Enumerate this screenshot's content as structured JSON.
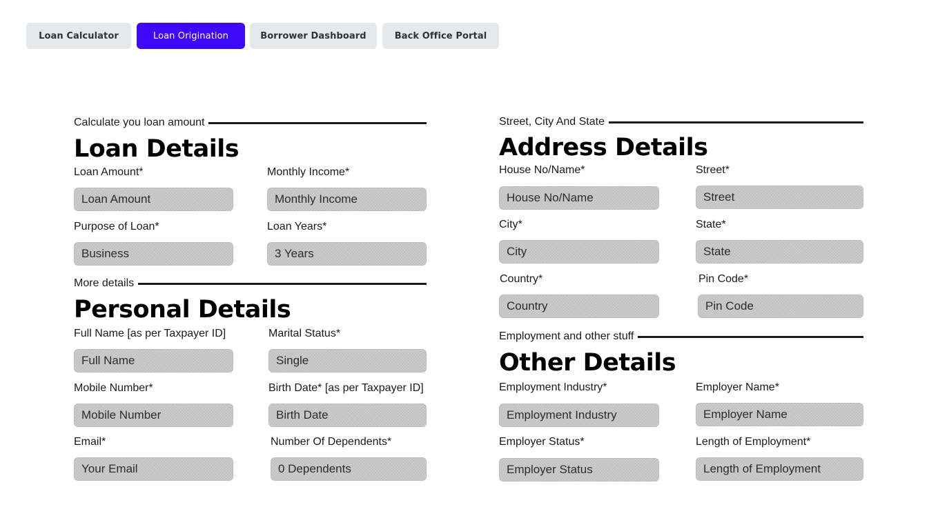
{
  "tabs": [
    {
      "label": "Loan Calculator",
      "active": false
    },
    {
      "label": "Loan Origination",
      "active": true
    },
    {
      "label": "Borrower Dashboard",
      "active": false
    },
    {
      "label": "Back Office Portal",
      "active": false
    }
  ],
  "colors": {
    "tab_active_bg": "#3d08f5",
    "tab_bg": "#e6e9ec",
    "input_bg": "#c8c8c8"
  },
  "loan": {
    "eyebrow": "Calculate you loan amount",
    "title": "Loan Details",
    "fields": [
      {
        "label": "Loan Amount*",
        "placeholder": "Loan Amount"
      },
      {
        "label": "Monthly Income*",
        "placeholder": "Monthly Income"
      },
      {
        "label": "Purpose of Loan*",
        "placeholder": "Business"
      },
      {
        "label": "Loan Years*",
        "placeholder": "3 Years"
      }
    ]
  },
  "personal": {
    "eyebrow": "More details",
    "title": "Personal Details",
    "fields": [
      {
        "label": "Full Name [as per Taxpayer ID]",
        "placeholder": "Full Name"
      },
      {
        "label": "Marital Status*",
        "placeholder": "Single"
      },
      {
        "label": "Mobile Number*",
        "placeholder": "Mobile Number"
      },
      {
        "label": "Birth Date* [as per Taxpayer ID]",
        "placeholder": "Birth Date"
      },
      {
        "label": "Email*",
        "placeholder": "Your Email"
      },
      {
        "label": "Number Of Dependents*",
        "placeholder": "0 Dependents"
      }
    ]
  },
  "address": {
    "eyebrow": "Street, City And State",
    "title": "Address Details",
    "fields": [
      {
        "label": "House No/Name*",
        "placeholder": "House No/Name"
      },
      {
        "label": "Street*",
        "placeholder": "Street"
      },
      {
        "label": "City*",
        "placeholder": "City"
      },
      {
        "label": "State*",
        "placeholder": "State"
      },
      {
        "label": "Country*",
        "placeholder": "Country"
      },
      {
        "label": "Pin Code*",
        "placeholder": "Pin Code"
      }
    ]
  },
  "other": {
    "eyebrow": "Employment and other stuff",
    "title": "Other Details",
    "fields": [
      {
        "label": "Employment Industry*",
        "placeholder": "Employment Industry"
      },
      {
        "label": "Employer Name*",
        "placeholder": "Employer Name"
      },
      {
        "label": "Employer Status*",
        "placeholder": "Employer Status"
      },
      {
        "label": "Length of Employment*",
        "placeholder": "Length of Employment"
      }
    ]
  }
}
